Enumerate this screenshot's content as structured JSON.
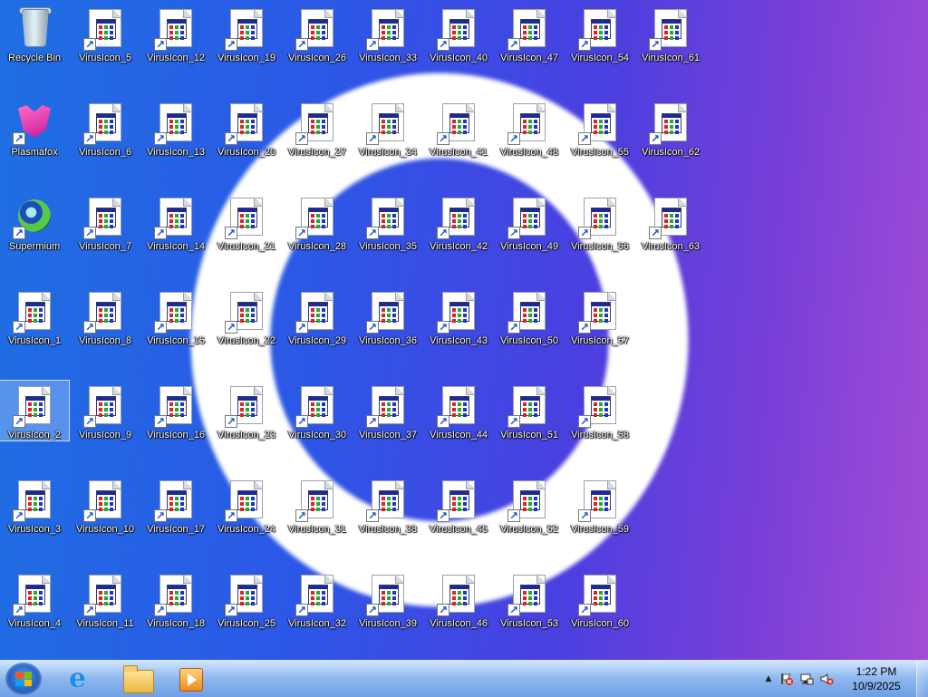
{
  "desktop": {
    "recycle_bin": "Recycle Bin",
    "plasmafox": "Plasmafox",
    "supermium": "Supermium",
    "virus_icons": [
      "VirusIcon_1",
      "VirusIcon_2",
      "VirusIcon_3",
      "VirusIcon_4",
      "VirusIcon_5",
      "VirusIcon_6",
      "VirusIcon_7",
      "VirusIcon_8",
      "VirusIcon_9",
      "VirusIcon_10",
      "VirusIcon_11",
      "VirusIcon_12",
      "VirusIcon_13",
      "VirusIcon_14",
      "VirusIcon_15",
      "VirusIcon_16",
      "VirusIcon_17",
      "VirusIcon_18",
      "VirusIcon_19",
      "VirusIcon_20",
      "VirusIcon_21",
      "VirusIcon_22",
      "VirusIcon_23",
      "VirusIcon_24",
      "VirusIcon_25",
      "VirusIcon_26",
      "VirusIcon_27",
      "VirusIcon_28",
      "VirusIcon_29",
      "VirusIcon_30",
      "VirusIcon_31",
      "VirusIcon_32",
      "VirusIcon_33",
      "VirusIcon_34",
      "VirusIcon_35",
      "VirusIcon_36",
      "VirusIcon_37",
      "VirusIcon_38",
      "VirusIcon_39",
      "VirusIcon_40",
      "VirusIcon_41",
      "VirusIcon_42",
      "VirusIcon_43",
      "VirusIcon_44",
      "VirusIcon_45",
      "VirusIcon_46",
      "VirusIcon_47",
      "VirusIcon_48",
      "VirusIcon_49",
      "VirusIcon_50",
      "VirusIcon_51",
      "VirusIcon_52",
      "VirusIcon_53",
      "VirusIcon_54",
      "VirusIcon_55",
      "VirusIcon_56",
      "VirusIcon_57",
      "VirusIcon_58",
      "VirusIcon_59",
      "VirusIcon_60",
      "VirusIcon_61",
      "VirusIcon_62",
      "VirusIcon_63"
    ],
    "selected_icon": "VirusIcon_2"
  },
  "taskbar": {
    "start_icon": "windows-start-icon",
    "pinned": [
      {
        "icon": "internet-explorer-icon"
      },
      {
        "icon": "file-explorer-icon"
      },
      {
        "icon": "media-player-icon"
      }
    ],
    "tray": {
      "show_hidden": "▲",
      "icons": [
        "action-center-flag-icon",
        "network-icon",
        "volume-muted-icon"
      ],
      "time": "1:22 PM",
      "date": "10/9/2025"
    }
  },
  "colors": {
    "wallpaper_left": "#1f6fe3",
    "wallpaper_right": "#a24dd6",
    "swirl": "#ffffff"
  }
}
